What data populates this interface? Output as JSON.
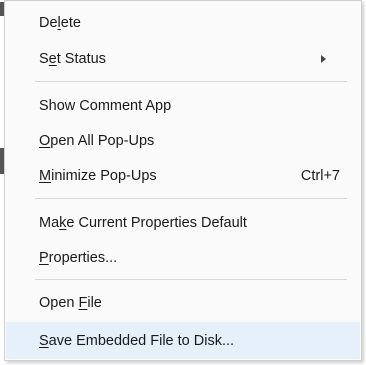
{
  "context_menu": {
    "items": [
      {
        "pre": "De",
        "key": "l",
        "post": "ete",
        "shortcut": "",
        "submenu": false
      },
      {
        "pre": "S",
        "key": "e",
        "post": "t Status",
        "shortcut": "",
        "submenu": true
      },
      {
        "pre": "Show Comment App",
        "key": "",
        "post": "",
        "shortcut": "",
        "submenu": false
      },
      {
        "pre": "",
        "key": "O",
        "post": "pen All Pop-Ups",
        "shortcut": "",
        "submenu": false
      },
      {
        "pre": "",
        "key": "M",
        "post": "inimize Pop-Ups",
        "shortcut": "Ctrl+7",
        "submenu": false
      },
      {
        "pre": "Ma",
        "key": "k",
        "post": "e Current Properties Default",
        "shortcut": "",
        "submenu": false
      },
      {
        "pre": "",
        "key": "P",
        "post": "roperties...",
        "shortcut": "",
        "submenu": false
      },
      {
        "pre": "Open ",
        "key": "F",
        "post": "ile",
        "shortcut": "",
        "submenu": false
      },
      {
        "pre": "",
        "key": "S",
        "post": "ave Embedded File to Disk...",
        "shortcut": "",
        "submenu": false
      }
    ],
    "highlighted_item": "Save Embedded File to Disk...",
    "colors": {
      "menu_background": "#fafafa",
      "hover_background": "#e5f0fb",
      "separator": "#d7d7d7",
      "text": "#1a1a1a"
    }
  }
}
